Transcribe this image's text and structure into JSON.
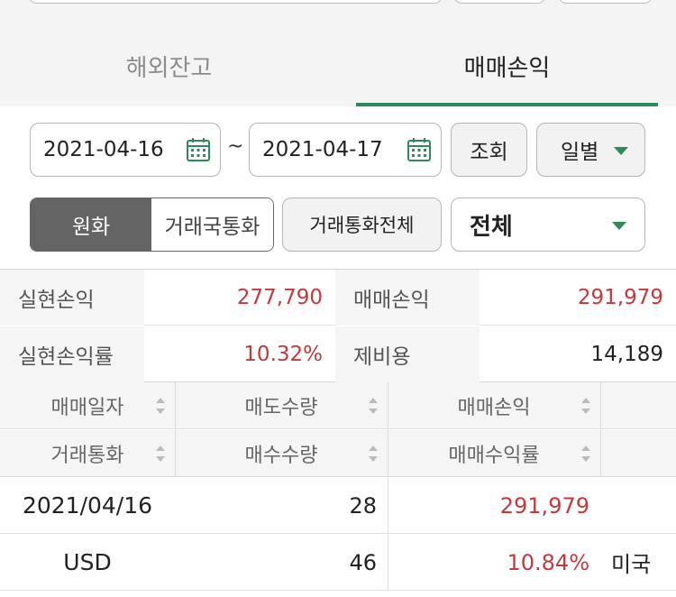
{
  "tabs": [
    {
      "label": "해외잔고",
      "active": false
    },
    {
      "label": "매매손익",
      "active": true
    }
  ],
  "filters": {
    "start_date": "2021-04-16",
    "date_separator": "~",
    "end_date": "2021-04-17",
    "query_label": "조회",
    "period_label": "일별",
    "currency_toggle": [
      {
        "label": "원화",
        "active": true
      },
      {
        "label": "거래국통화",
        "active": false
      }
    ],
    "all_currency_label": "거래통화전체",
    "country_select_label": "전체"
  },
  "summary": {
    "realized_pl_label": "실현손익",
    "realized_pl_value": "277,790",
    "trade_pl_label": "매매손익",
    "trade_pl_value": "291,979",
    "realized_rate_label": "실현손익률",
    "realized_rate_value": "10.32%",
    "fees_label": "제비용",
    "fees_value": "14,189"
  },
  "table": {
    "header_row1": [
      "매매일자",
      "매도수량",
      "매매손익"
    ],
    "header_row2": [
      "거래통화",
      "매수수량",
      "매매수익률"
    ],
    "rows": [
      {
        "c1": "2021/04/16",
        "c2": "28",
        "c3": "291,979",
        "c4": ""
      },
      {
        "c1": "USD",
        "c2": "46",
        "c3": "10.84%",
        "c4": "미국"
      }
    ]
  },
  "colors": {
    "accent_green": "#2d8a5a",
    "profit_red": "#c8373a",
    "toggle_dark": "#646464"
  },
  "icons": {
    "date_picker": "calendar-icon",
    "dropdown": "caret-down-icon",
    "sort": "sort-icon"
  }
}
